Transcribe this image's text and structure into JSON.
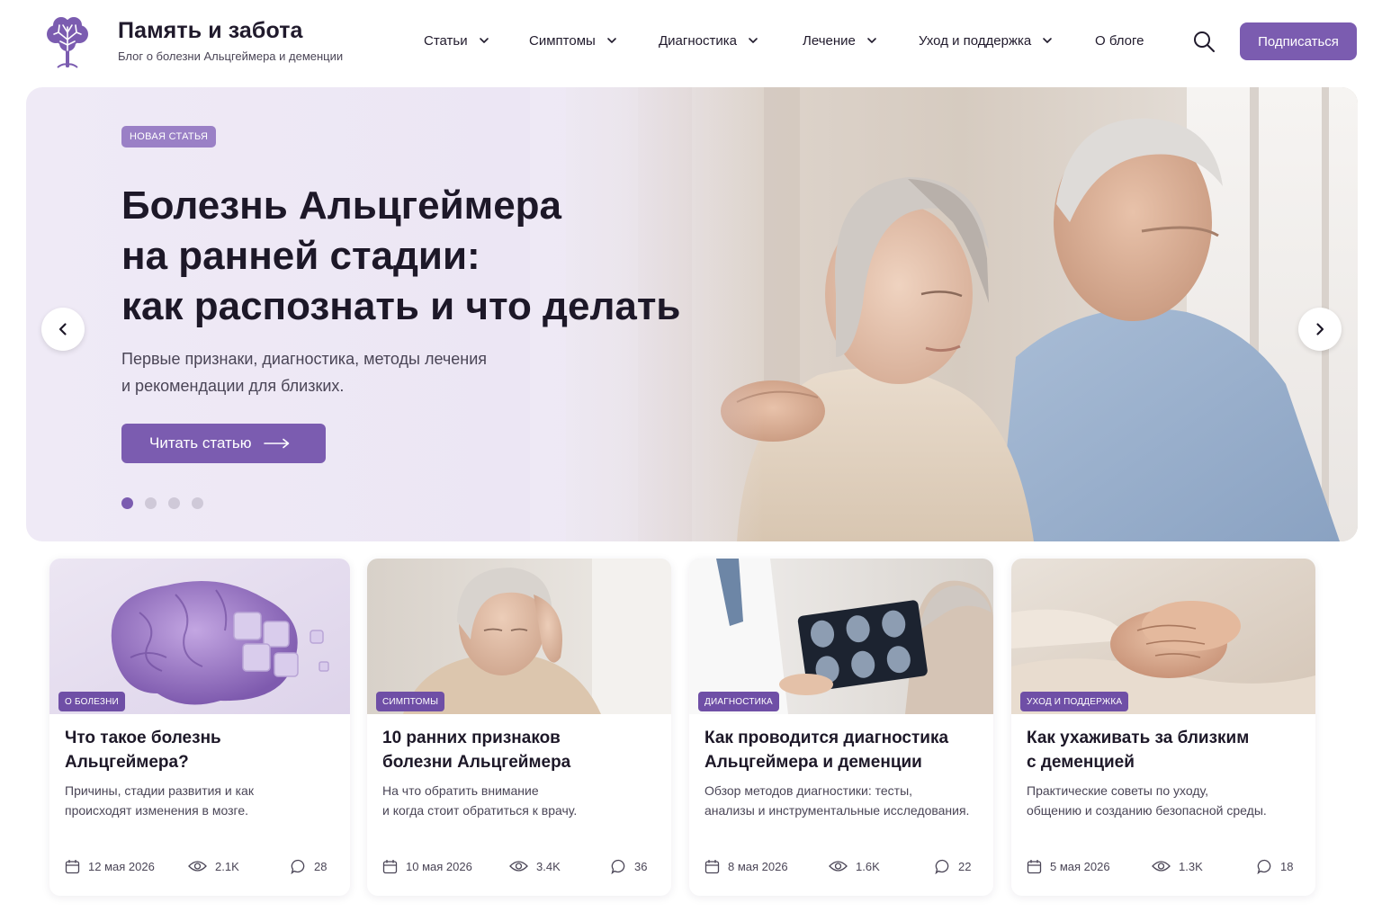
{
  "brand": {
    "title": "Память и забота",
    "subtitle": "Блог о болезни Альцгеймера и деменции"
  },
  "nav": [
    {
      "label": "Статьи",
      "dropdown": true
    },
    {
      "label": "Симптомы",
      "dropdown": true
    },
    {
      "label": "Диагностика",
      "dropdown": true
    },
    {
      "label": "Лечение",
      "dropdown": true
    },
    {
      "label": "Уход и поддержка",
      "dropdown": true
    },
    {
      "label": "О блоге",
      "dropdown": false
    }
  ],
  "subscribe_label": "Подписаться",
  "hero": {
    "badge": "НОВАЯ СТАТЬЯ",
    "title_lines": [
      "Болезнь Альцгеймера",
      "на ранней стадии:",
      "как распознать и что делать"
    ],
    "desc_lines": [
      "Первые признаки, диагностика, методы лечения",
      "и рекомендации для близких."
    ],
    "button": "Читать статью",
    "slides_total": 4,
    "active_slide": 1
  },
  "cards": [
    {
      "tag": "О БОЛЕЗНИ",
      "title_lines": [
        "Что такое болезнь",
        "Альцгеймера?"
      ],
      "desc_lines": [
        "Причины, стадии развития и как",
        "происходят изменения в мозге."
      ],
      "date": "12 мая 2026",
      "views": "2.1K",
      "comments": "28"
    },
    {
      "tag": "СИМПТОМЫ",
      "title_lines": [
        "10 ранних признаков",
        "болезни Альцгеймера"
      ],
      "desc_lines": [
        "На что обратить внимание",
        "и когда стоит обратиться к врачу."
      ],
      "date": "10 мая 2026",
      "views": "3.4K",
      "comments": "36"
    },
    {
      "tag": "ДИАГНОСТИКА",
      "title_lines": [
        "Как проводится диагностика",
        "Альцгеймера и деменции"
      ],
      "desc_lines": [
        "Обзор методов диагностики: тесты,",
        "анализы и инструментальные исследования."
      ],
      "date": "8 мая 2026",
      "views": "1.6K",
      "comments": "22"
    },
    {
      "tag": "УХОД И ПОДДЕРЖКА",
      "title_lines": [
        "Как ухаживать за близким",
        "с деменцией"
      ],
      "desc_lines": [
        "Практические советы по уходу,",
        "общению и созданию безопасной среды."
      ],
      "date": "5 мая 2026",
      "views": "1.3K",
      "comments": "18"
    }
  ],
  "icons": {
    "logo": "brain-tree-icon",
    "search": "search-icon",
    "prev": "chevron-left-icon",
    "next": "chevron-right-icon",
    "date": "calendar-icon",
    "views": "eye-icon",
    "comments": "comment-icon"
  },
  "colors": {
    "accent": "#7b5cb0",
    "badge": "#9a80c6",
    "tag": "#6f4fa6",
    "hero_bg": "#efeaf6"
  }
}
